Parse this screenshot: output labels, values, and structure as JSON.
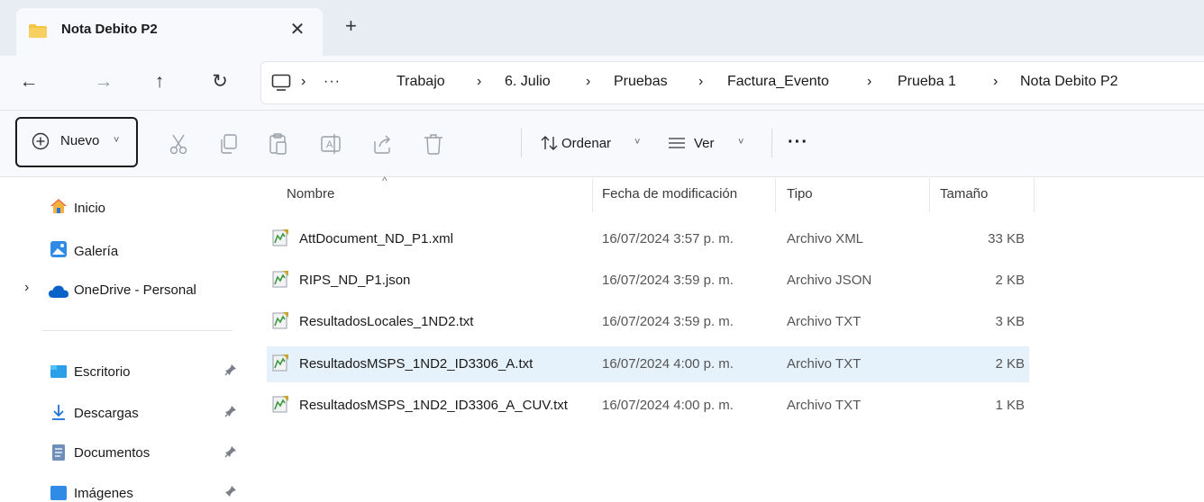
{
  "tab": {
    "title": "Nota Debito P2",
    "close": "✕",
    "new": "+"
  },
  "nav": {
    "back": "←",
    "forward": "→",
    "up": "↑",
    "refresh": "↻"
  },
  "breadcrumb": {
    "more": "···",
    "separator": "›",
    "items": [
      "Trabajo",
      "6. Julio",
      "Pruebas",
      "Factura_Evento",
      "Prueba 1",
      "Nota Debito P2"
    ]
  },
  "toolbar": {
    "new_label": "Nuevo",
    "sort_label": "Ordenar",
    "view_label": "Ver",
    "more": "···",
    "chevron": "˅"
  },
  "sidebar": {
    "items": [
      {
        "label": "Inicio",
        "icon": "home-icon"
      },
      {
        "label": "Galería",
        "icon": "gallery-icon"
      },
      {
        "label": "OneDrive - Personal",
        "icon": "cloud-icon"
      },
      {
        "label": "Escritorio",
        "icon": "desktop-icon"
      },
      {
        "label": "Descargas",
        "icon": "download-icon"
      },
      {
        "label": "Documentos",
        "icon": "documents-icon"
      },
      {
        "label": "Imágenes",
        "icon": "pictures-icon"
      }
    ],
    "expand": "›"
  },
  "columns": {
    "name": "Nombre",
    "date": "Fecha de modificación",
    "type": "Tipo",
    "size": "Tamaño"
  },
  "files": [
    {
      "name": "AttDocument_ND_P1.xml",
      "date": "16/07/2024 3:57 p. m.",
      "type": "Archivo XML",
      "size": "33 KB"
    },
    {
      "name": "RIPS_ND_P1.json",
      "date": "16/07/2024 3:59 p. m.",
      "type": "Archivo JSON",
      "size": "2 KB"
    },
    {
      "name": "ResultadosLocales_1ND2.txt",
      "date": "16/07/2024 3:59 p. m.",
      "type": "Archivo TXT",
      "size": "3 KB"
    },
    {
      "name": "ResultadosMSPS_1ND2_ID3306_A.txt",
      "date": "16/07/2024 4:00 p. m.",
      "type": "Archivo TXT",
      "size": "2 KB"
    },
    {
      "name": "ResultadosMSPS_1ND2_ID3306_A_CUV.txt",
      "date": "16/07/2024 4:00 p. m.",
      "type": "Archivo TXT",
      "size": "1 KB"
    }
  ],
  "colors": {
    "selected_row": "#e5f1fb",
    "accent": "#0067c0",
    "folder": "#f4c542"
  }
}
